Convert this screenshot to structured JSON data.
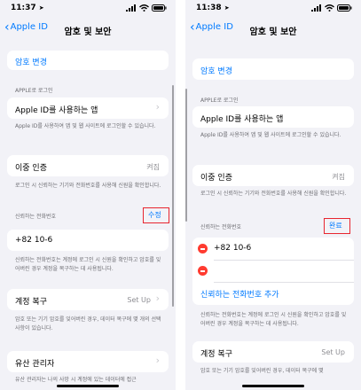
{
  "left": {
    "status": {
      "time": "11:37"
    },
    "nav": {
      "back": "Apple ID",
      "title": "암호 및 보안"
    },
    "change_password": "암호 변경",
    "apple_login_header": "APPLE로 로그인",
    "apps_using_apple_id": "Apple ID를 사용하는 앱",
    "apps_note": "Apple ID를 사용하여 앱 및 웹 사이트에 로그인할 수 있습니다.",
    "two_factor": {
      "label": "이중 인증",
      "value": "켜짐"
    },
    "two_factor_note": "로그인 시 신뢰하는 기기와 전화번호를 사용해 신원을 확인합니다.",
    "trusted_header": "신뢰하는 전화번호",
    "edit": "수정",
    "phone": "+82 10-6",
    "phone_note": "신뢰하는 전화번호는 계정에 로그인 시 신원을 확인하고 암호를 잊어버린 경우 계정을 복구하는 데 사용됩니다.",
    "recovery": {
      "label": "계정 복구",
      "value": "Set Up"
    },
    "recovery_note": "암호 또는 기기 암호를 잊어버린 경우, 데이터 복구에 몇 개의 선택 사항이 있습니다.",
    "legacy": "유산 관리자",
    "legacy_note": "유산 관리자는 나의 사망 시 계정에 있는 데이터에 접근"
  },
  "right": {
    "status": {
      "time": "11:38"
    },
    "nav": {
      "back": "Apple ID",
      "title": "암호 및 보안"
    },
    "change_password": "암호 변경",
    "apple_login_header": "APPLE로 로그인",
    "apps_using_apple_id": "Apple ID를 사용하는 앱",
    "apps_note": "Apple ID를 사용하여 앱 및 웹 사이트에 로그인할 수 있습니다.",
    "two_factor": {
      "label": "이중 인증",
      "value": "켜짐"
    },
    "two_factor_note": "로그인 시 신뢰하는 기기와 전화번호를 사용해 신원을 확인합니다.",
    "trusted_header": "신뢰하는 전화번호",
    "done": "완료",
    "phone": "+82 10-6",
    "add_trusted": "신뢰하는 전화번호 추가",
    "phone_note": "신뢰하는 전화번호는 계정에 로그인 시 신원을 확인하고 암호를 잊어버린 경우 계정을 복구하는 데 사용됩니다.",
    "recovery": {
      "label": "계정 복구",
      "value": "Set Up"
    },
    "recovery_note": "암호 또는 기기 암호를 잊어버린 경우, 데이터 복구에 몇"
  },
  "colors": {
    "accent": "#007aff",
    "highlight": "#e8252f",
    "destructive": "#ff3b30"
  }
}
